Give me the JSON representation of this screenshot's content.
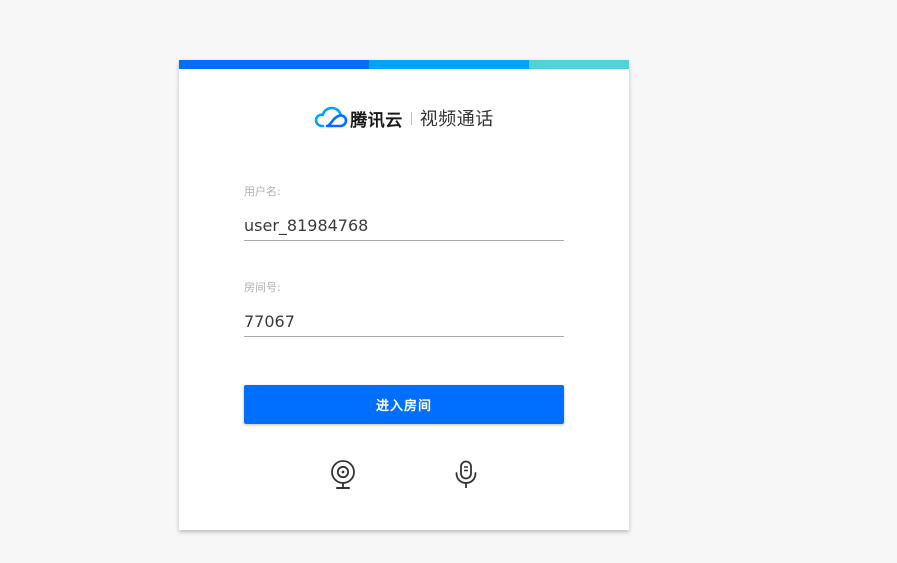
{
  "colors": {
    "page_background": "#f7f7f7",
    "card_background": "#ffffff",
    "topbar_segment_1": "#006eff",
    "topbar_segment_2": "#00a4ff",
    "topbar_segment_3": "#4fd2d8",
    "logo_blue": "#00a4ff",
    "logo_dark_blue": "#006eff",
    "primary_button": "#006eff",
    "icon_color": "#333333"
  },
  "brand": {
    "logo_icon": "tencent-cloud-logo-icon",
    "company": "腾讯云",
    "app_title": "视频通话"
  },
  "form": {
    "username": {
      "label": "用户名:",
      "value": "user_81984768"
    },
    "room": {
      "label": "房间号:",
      "value": "77067"
    },
    "enter_button_label": "进入房间"
  },
  "devices": {
    "camera_icon": "camera-icon",
    "microphone_icon": "microphone-icon"
  }
}
